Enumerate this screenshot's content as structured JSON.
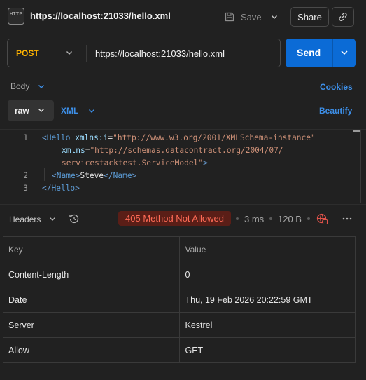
{
  "header": {
    "icon_text": "HTTP",
    "title": "https://localhost:21033/hello.xml",
    "save_label": "Save",
    "share_label": "Share"
  },
  "request": {
    "method": "POST",
    "url": "https://localhost:21033/hello.xml",
    "send_label": "Send"
  },
  "body_tabs": {
    "body_label": "Body",
    "cookies_label": "Cookies",
    "raw_label": "raw",
    "xml_label": "XML",
    "beautify_label": "Beautify"
  },
  "code": {
    "line_numbers": [
      "1",
      "2",
      "3"
    ],
    "l1_open": "<",
    "l1_tag": "Hello",
    "l1_attr1": "xmlns:i",
    "l1_eq1": "=",
    "l1_str1": "\"http://www.w3.org/2001/XMLSchema-instance\"",
    "l1b_attr2": "xmlns",
    "l1b_eq2": "=",
    "l1b_str2": "\"http://schemas.datacontract.org/2004/07/",
    "l1c_str2": "servicestacktest.ServiceModel\"",
    "l1c_close": ">",
    "l2_open": "<",
    "l2_tag": "Name",
    "l2_close": ">",
    "l2_text": "Steve",
    "l2_end_open": "</",
    "l2_end_tag": "Name",
    "l2_end_close": ">",
    "l3_open": "</",
    "l3_tag": "Hello",
    "l3_close": ">"
  },
  "response": {
    "headers_label": "Headers",
    "status": "405 Method Not Allowed",
    "time": "3 ms",
    "size": "120 B",
    "status_color": "#ff6b56"
  },
  "table": {
    "columns": [
      "Key",
      "Value"
    ],
    "rows": [
      {
        "key": "Content-Length",
        "value": "0"
      },
      {
        "key": "Date",
        "value": "Thu, 19 Feb 2026 20:22:59 GMT"
      },
      {
        "key": "Server",
        "value": "Kestrel"
      },
      {
        "key": "Allow",
        "value": "GET"
      }
    ]
  },
  "colors": {
    "accent": "#0b6bd6",
    "link": "#3d8fe8",
    "method": "#ffb400",
    "error_bg": "#5a1e17"
  },
  "icons": [
    "http-icon",
    "save-icon",
    "chevron-down-icon",
    "link-icon",
    "history-icon",
    "globe-icon",
    "more-icon"
  ]
}
